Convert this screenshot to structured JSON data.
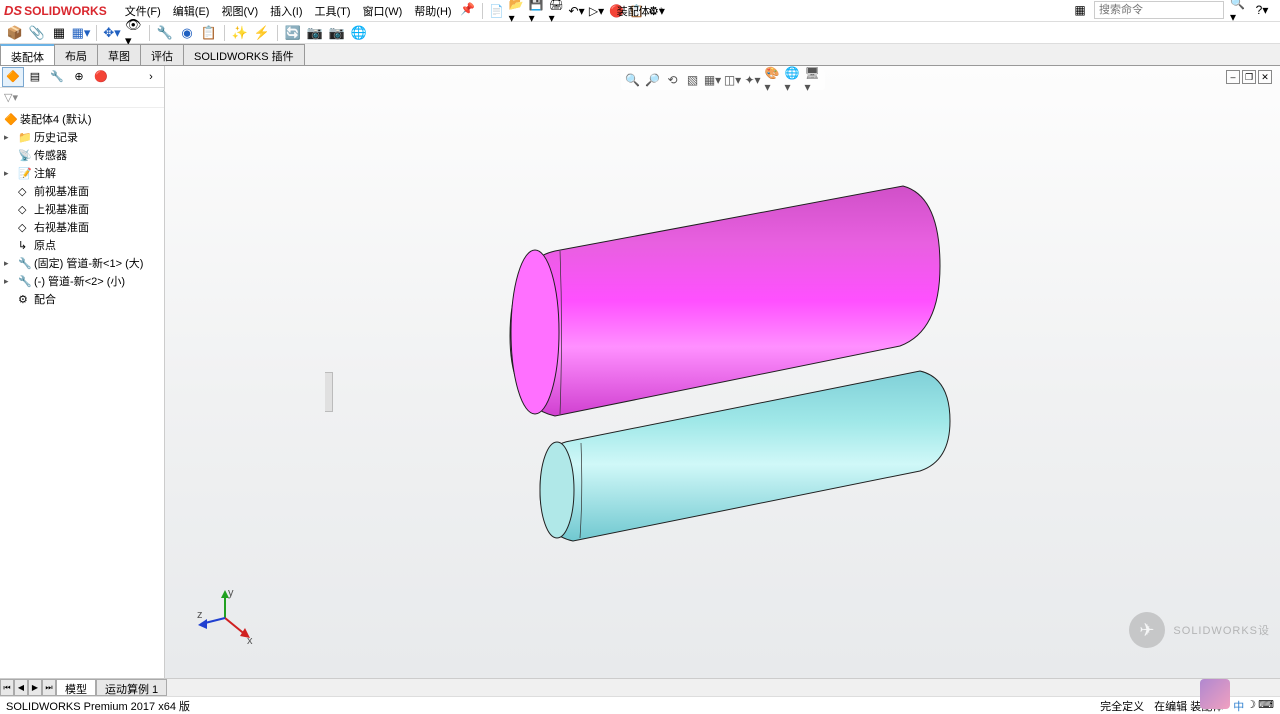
{
  "logo": {
    "ds": "DS",
    "text": "SOLIDWORKS"
  },
  "menus": [
    "文件(F)",
    "编辑(E)",
    "视图(V)",
    "插入(I)",
    "工具(T)",
    "窗口(W)",
    "帮助(H)"
  ],
  "doc_title": "装配体4 *",
  "search_placeholder": "搜索命令",
  "tabs": [
    "装配体",
    "布局",
    "草图",
    "评估",
    "SOLIDWORKS 插件"
  ],
  "active_tab": 0,
  "tree": {
    "root": "装配体4  (默认)",
    "items": [
      {
        "icon": "📁",
        "label": "历史记录",
        "exp": "▸",
        "indent": 1
      },
      {
        "icon": "📡",
        "label": "传感器",
        "exp": "",
        "indent": 1
      },
      {
        "icon": "📝",
        "label": "注解",
        "exp": "▸",
        "indent": 1
      },
      {
        "icon": "◇",
        "label": "前视基准面",
        "exp": "",
        "indent": 1
      },
      {
        "icon": "◇",
        "label": "上视基准面",
        "exp": "",
        "indent": 1
      },
      {
        "icon": "◇",
        "label": "右视基准面",
        "exp": "",
        "indent": 1
      },
      {
        "icon": "↳",
        "label": "原点",
        "exp": "",
        "indent": 1
      },
      {
        "icon": "🔧",
        "label": "(固定) 管道-新<1> (大)",
        "exp": "▸",
        "indent": 1
      },
      {
        "icon": "🔧",
        "label": "(-) 管道-新<2> (小)",
        "exp": "▸",
        "indent": 1
      },
      {
        "icon": "⚙",
        "label": "配合",
        "exp": "",
        "indent": 1
      }
    ]
  },
  "bottom_tabs": [
    "模型",
    "运动算例 1"
  ],
  "status_left": "SOLIDWORKS Premium 2017 x64 版",
  "status_right": [
    "完全定义",
    "在编辑 装配体"
  ],
  "watermark": "SOLIDWORKS设"
}
